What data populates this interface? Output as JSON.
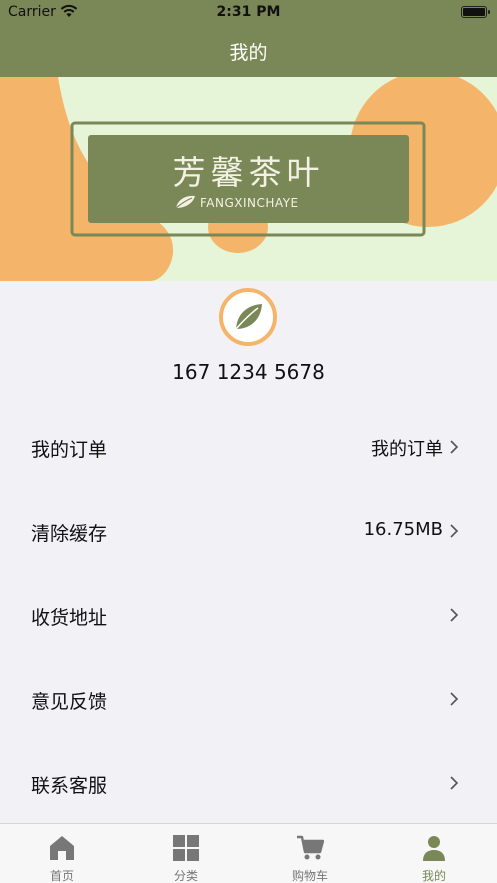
{
  "status_bar": {
    "carrier": "Carrier",
    "time": "2:31 PM"
  },
  "nav": {
    "title": "我的"
  },
  "banner": {
    "brand_name": "芳馨茶叶",
    "brand_pinyin": "FANGXINCHAYE"
  },
  "profile": {
    "phone": "167 1234 5678"
  },
  "menu": [
    {
      "label": "我的订单",
      "value": "我的订单"
    },
    {
      "label": "清除缓存",
      "value": "16.75MB"
    },
    {
      "label": "收货地址",
      "value": ""
    },
    {
      "label": "意见反馈",
      "value": ""
    },
    {
      "label": "联系客服",
      "value": ""
    }
  ],
  "tabs": [
    {
      "label": "首页",
      "icon": "home-icon"
    },
    {
      "label": "分类",
      "icon": "grid-icon"
    },
    {
      "label": "购物车",
      "icon": "cart-icon"
    },
    {
      "label": "我的",
      "icon": "person-icon",
      "active": true
    }
  ],
  "colors": {
    "brand_green": "#798856",
    "accent_orange": "#f4b56a",
    "banner_cream": "#e6f4d7"
  }
}
